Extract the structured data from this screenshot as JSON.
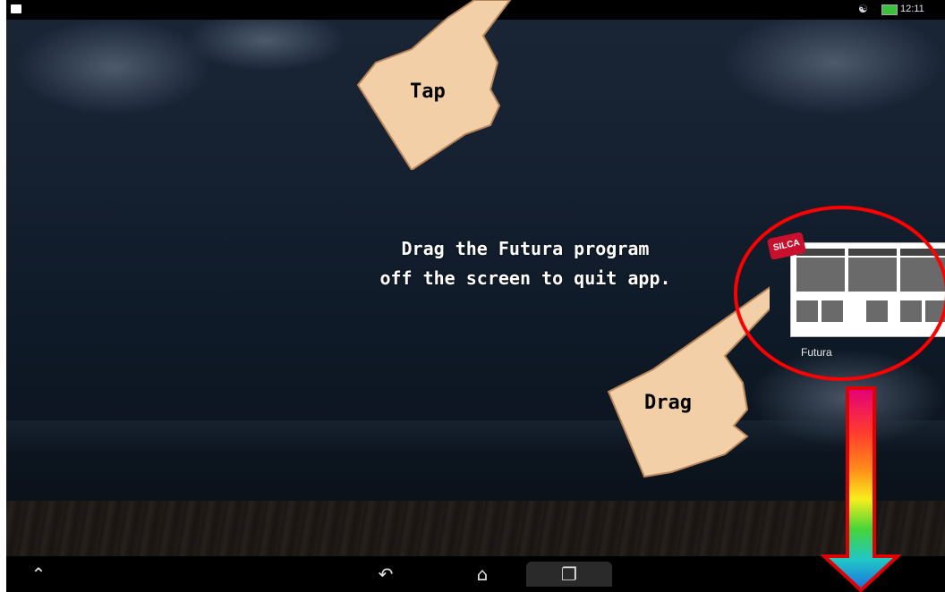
{
  "status_bar": {
    "time": "12:11"
  },
  "nav_bar": {
    "back_icon": "back-arrow-icon",
    "home_icon": "home-icon",
    "recents_icon": "recent-apps-icon",
    "menu_icon": "menu-chevron-icon"
  },
  "recent_app": {
    "label": "Futura",
    "badge": "SILCA"
  },
  "annotations": {
    "tap_label": "Tap",
    "drag_label": "Drag",
    "instruction_line1": "Drag the Futura program",
    "instruction_line2": "off the screen to quit app."
  },
  "colors": {
    "highlight_ellipse": "#ff0000",
    "brand_red": "#c8102e"
  }
}
